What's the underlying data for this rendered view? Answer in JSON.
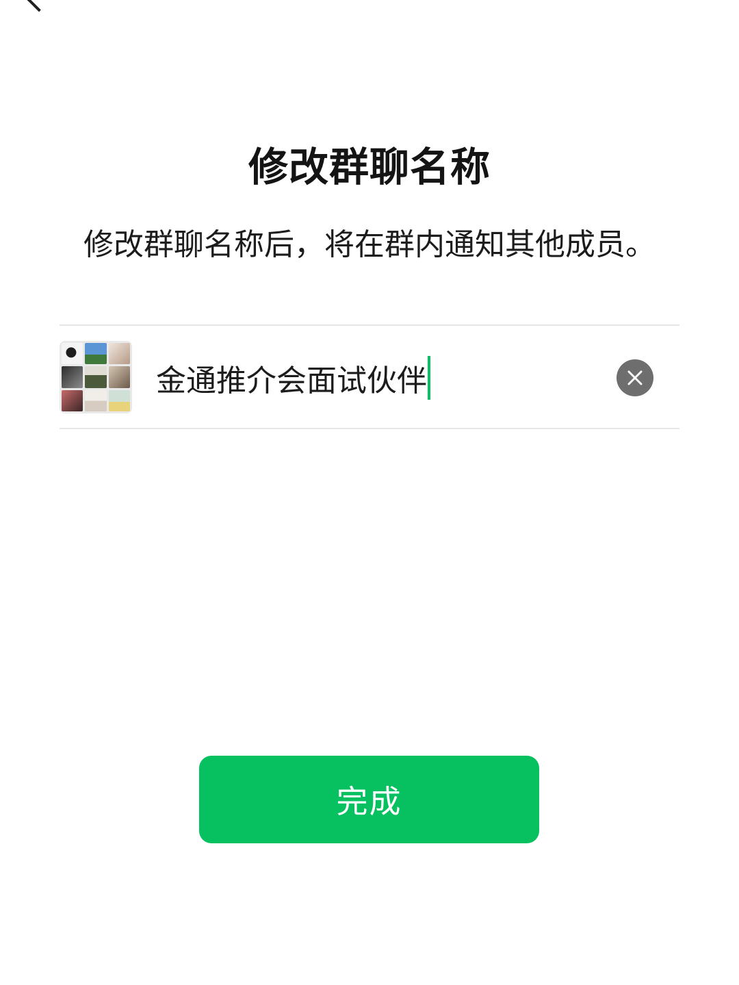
{
  "header": {
    "back_icon": "chevron-left-icon"
  },
  "page": {
    "title": "修改群聊名称",
    "subtitle": "修改群聊名称后，将在群内通知其他成员。"
  },
  "group": {
    "avatar": "group-avatar-grid",
    "name_value": "金通推介会面试伙伴",
    "clear_icon": "clear-icon"
  },
  "actions": {
    "done_label": "完成"
  },
  "colors": {
    "accent": "#07c160",
    "clear_icon_bg": "#6e6e6e",
    "divider": "#e6e6e6"
  }
}
